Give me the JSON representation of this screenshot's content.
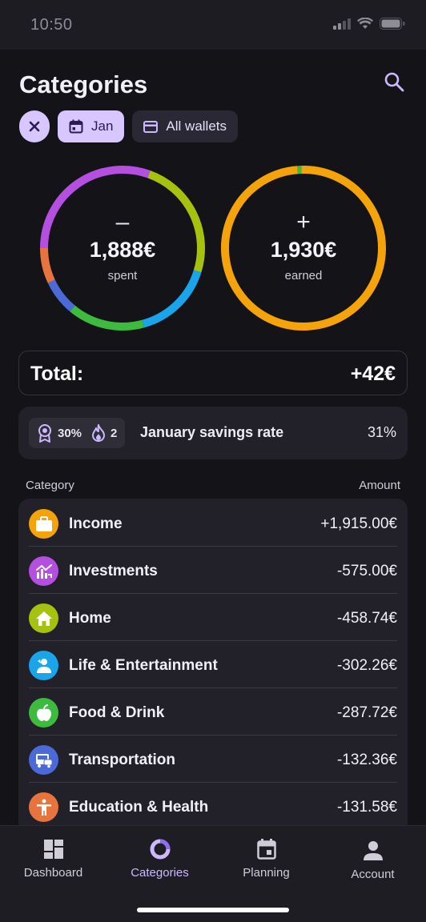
{
  "status_bar": {
    "time": "10:50"
  },
  "header": {
    "title": "Categories"
  },
  "filters": {
    "month": "Jan",
    "wallet": "All wallets"
  },
  "summary": {
    "spent": {
      "sign": "–",
      "amount": "1,888€",
      "label": "spent"
    },
    "earned": {
      "sign": "+",
      "amount": "1,930€",
      "label": "earned"
    }
  },
  "total": {
    "label": "Total:",
    "value": "+42€"
  },
  "savings": {
    "badge_percent": "30%",
    "streak": "2",
    "title": "January savings rate",
    "rate": "31%"
  },
  "columns": {
    "category": "Category",
    "amount": "Amount"
  },
  "categories": [
    {
      "name": "Income",
      "amount": "+1,915.00€",
      "color": "#f5a30a",
      "icon": "briefcase-icon"
    },
    {
      "name": "Investments",
      "amount": "-575.00€",
      "color": "#b44fe0",
      "icon": "chart-icon"
    },
    {
      "name": "Home",
      "amount": "-458.74€",
      "color": "#a6c20f",
      "icon": "home-icon"
    },
    {
      "name": "Life & Entertainment",
      "amount": "-302.26€",
      "color": "#1aa5ea",
      "icon": "person-icon"
    },
    {
      "name": "Food & Drink",
      "amount": "-287.72€",
      "color": "#3dbb3f",
      "icon": "apple-icon"
    },
    {
      "name": "Transportation",
      "amount": "-132.36€",
      "color": "#4b6ad8",
      "icon": "bus-icon"
    },
    {
      "name": "Education & Health",
      "amount": "-131.58€",
      "color": "#e8743d",
      "icon": "accessibility-icon"
    }
  ],
  "spent_ring": [
    {
      "category": "Investments",
      "value": 575,
      "color": "#b44fe0"
    },
    {
      "category": "Home",
      "value": 458.74,
      "color": "#a6c20f"
    },
    {
      "category": "Life & Entertainment",
      "value": 302.26,
      "color": "#1aa5ea"
    },
    {
      "category": "Food & Drink",
      "value": 287.72,
      "color": "#3dbb3f"
    },
    {
      "category": "Transportation",
      "value": 132.36,
      "color": "#4b6ad8"
    },
    {
      "category": "Education & Health",
      "value": 131.58,
      "color": "#e8743d"
    }
  ],
  "earned_ring": [
    {
      "category": "Income",
      "value": 1915,
      "color": "#f5a30a"
    },
    {
      "category": "Other",
      "value": 15,
      "color": "#3dbb3f"
    }
  ],
  "nav": [
    {
      "label": "Dashboard",
      "icon": "dashboard-icon",
      "active": false
    },
    {
      "label": "Categories",
      "icon": "categories-icon",
      "active": true
    },
    {
      "label": "Planning",
      "icon": "calendar-icon",
      "active": false
    },
    {
      "label": "Account",
      "icon": "account-icon",
      "active": false
    }
  ],
  "colors": {
    "accent": "#d7c6ff",
    "background": "#141318",
    "card": "#22212a"
  }
}
